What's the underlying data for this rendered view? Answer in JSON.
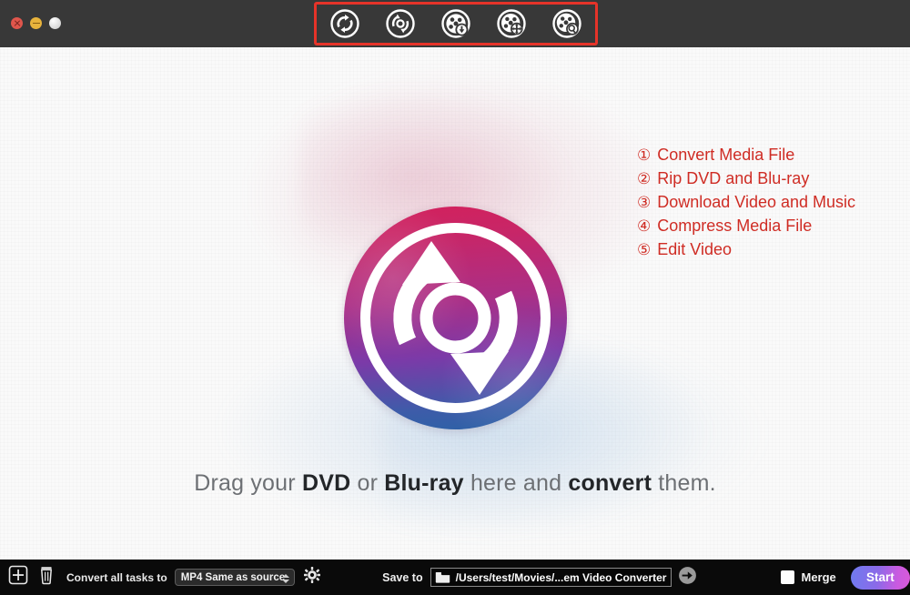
{
  "window": {
    "controls": [
      {
        "name": "close",
        "color": "#e0564c"
      },
      {
        "name": "minimize",
        "color": "#e8b33c"
      },
      {
        "name": "maximize",
        "color": "#d2d2d2"
      }
    ]
  },
  "toolbar": {
    "highlight_color": "#e63329",
    "buttons": [
      {
        "id": "convert",
        "icon": "convert-icon",
        "tooltip": "Convert Media File",
        "active": true
      },
      {
        "id": "ripper",
        "icon": "dvd-ripper-icon",
        "tooltip": "Rip DVD and Blu-ray",
        "active": false
      },
      {
        "id": "download",
        "icon": "download-reel-icon",
        "tooltip": "Download Video and Music",
        "active": false
      },
      {
        "id": "compress",
        "icon": "compress-reel-icon",
        "tooltip": "Compress Media File",
        "active": false
      },
      {
        "id": "edit",
        "icon": "edit-reel-icon",
        "tooltip": "Edit Video",
        "active": false
      }
    ],
    "markers": [
      "①",
      "②",
      "③",
      "④",
      "⑤"
    ]
  },
  "annotations": {
    "color": "#cf2c24",
    "items": [
      {
        "num": "①",
        "label": "Convert Media File"
      },
      {
        "num": "②",
        "label": "Rip DVD and Blu-ray"
      },
      {
        "num": "③",
        "label": "Download Video and Music"
      },
      {
        "num": "④",
        "label": "Compress Media File"
      },
      {
        "num": "⑤",
        "label": "Edit Video"
      }
    ]
  },
  "main": {
    "logo_icon": "convert-circle-logo",
    "drop_text": {
      "part1": "Drag your ",
      "bold1": "DVD",
      "part2": " or ",
      "bold2": "Blu-ray",
      "part3": " here and ",
      "bold3": "convert",
      "part4": " them."
    }
  },
  "bottom": {
    "add_icon": "add-file-icon",
    "delete_icon": "trash-icon",
    "convert_all_label": "Convert all tasks to",
    "format_select": {
      "value": "MP4 Same as source",
      "stepper_icon": "up-down-stepper-icon"
    },
    "settings_icon": "gear-icon",
    "save_to_label": "Save to",
    "folder_icon": "folder-icon",
    "save_path": "/Users/test/Movies/...em Video Converter",
    "open_icon": "arrow-right-circle-icon",
    "merge": {
      "label": "Merge",
      "checked": false,
      "checkbox_icon": "checkbox-icon"
    },
    "start_label": "Start",
    "start_gradient": [
      "#6f7bef",
      "#d95ad8"
    ]
  }
}
